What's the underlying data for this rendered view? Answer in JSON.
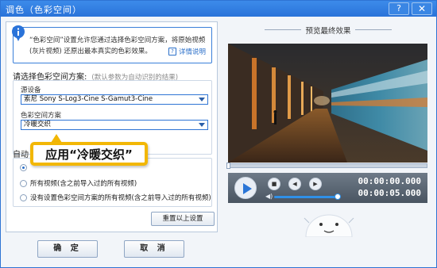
{
  "window": {
    "title": "调色（色彩空间）",
    "help_label": "?",
    "close_label": "✕"
  },
  "info": {
    "lines": [
      "“色彩空间”设置允许您通过选择色彩空间方案，将原始视频",
      "(灰片视频) 还原出最本真实的色彩效果。"
    ],
    "link_label": "详情说明"
  },
  "color_scheme": {
    "title": "请选择色彩空间方案:",
    "hint": "(默认参数为自动识别的结果)",
    "source_device_label": "源设备",
    "source_device_value": "索尼 Sony S-Log3-Cine S-Gamut3-Cine",
    "scheme_label": "色彩空间方案",
    "scheme_value": "冷暖交织"
  },
  "auto_apply": {
    "title": "自动",
    "options": [
      "",
      "所有视频(含之前导入过的所有视频)",
      "没有设置色彩空间方案的所有视频(含之前导入过的所有视频)"
    ],
    "selected_index": 0
  },
  "reset_label": "重置以上设置",
  "callout_text": "应用“冷暖交织”",
  "buttons": {
    "ok": "确 定",
    "cancel": "取 消"
  },
  "preview": {
    "title": "预览最终效果",
    "time_current": "00:00:00.000",
    "time_total": "00:00:05.000",
    "progress": 0.0,
    "volume": 0.95
  },
  "colors": {
    "titlebar": "#2a73d9",
    "accent": "#2e74d4",
    "callout_border": "#f2b705",
    "control_bar": "#5b6673"
  },
  "icons": [
    "info-icon",
    "help-question-icon",
    "close-icon",
    "play-icon",
    "stop-icon",
    "prev-frame-icon",
    "next-frame-icon",
    "volume-icon",
    "chevron-down-icon"
  ]
}
